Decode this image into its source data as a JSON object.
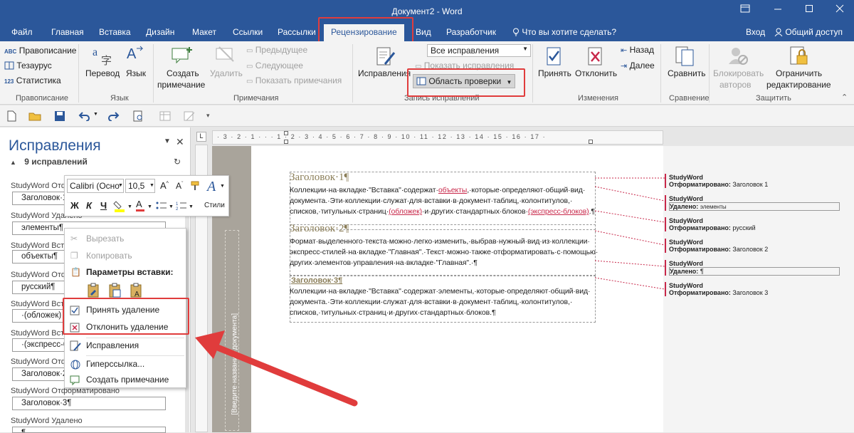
{
  "window": {
    "title": "Документ2 - Word",
    "controls": [
      "restore-ribbon",
      "minimize",
      "maximize",
      "close"
    ]
  },
  "tabs": {
    "file": "Файл",
    "home": "Главная",
    "insert": "Вставка",
    "design": "Дизайн",
    "layout": "Макет",
    "references": "Ссылки",
    "mailings": "Рассылки",
    "review": "Рецензирование",
    "view": "Вид",
    "developer": "Разработчик",
    "tell_me": "Что вы хотите сделать?",
    "signin": "Вход",
    "share": "Общий доступ"
  },
  "ribbon": {
    "proofing": {
      "spelling": "Правописание",
      "thesaurus": "Тезаурус",
      "stats": "Статистика",
      "label": "Правописание"
    },
    "language": {
      "translate": "Перевод",
      "language": "Язык",
      "label": "Язык"
    },
    "comments": {
      "new": [
        "Создать",
        "примечание"
      ],
      "delete": "Удалить",
      "previous": "Предыдущее",
      "next": "Следующее",
      "show": "Показать примечания",
      "label": "Примечания"
    },
    "tracking": {
      "track": "Исправления",
      "markup_select": "Все исправления",
      "show_markup": "Показать исправления",
      "reviewing_pane": "Область проверки",
      "label": "Запись исправлений"
    },
    "changes": {
      "accept": "Принять",
      "reject": "Отклонить",
      "back": "Назад",
      "forward": "Далее",
      "label": "Изменения"
    },
    "compare": {
      "compare": "Сравнить",
      "label": "Сравнение"
    },
    "protect": {
      "block": [
        "Блокировать",
        "авторов"
      ],
      "restrict": [
        "Ограничить",
        "редактирование"
      ],
      "label": "Защитить"
    }
  },
  "pane": {
    "title": "Исправления",
    "count": "9 исправлений",
    "entries": [
      {
        "head": "StudyWord Отф",
        "value": "Заголовок·1"
      },
      {
        "head": "StudyWord Удалено",
        "value": "элементы¶"
      },
      {
        "head": "StudyWord Вст",
        "value": "объекты¶"
      },
      {
        "head": "StudyWord Отф",
        "value": "русский¶"
      },
      {
        "head": "StudyWord Вст",
        "value": "·(обложек)"
      },
      {
        "head": "StudyWord Вст",
        "value": "·(экспресс-б"
      },
      {
        "head": "StudyWord Отф",
        "value": "Заголовок·2"
      },
      {
        "head": "StudyWord Отформатировано",
        "value": "Заголовок·3¶"
      },
      {
        "head": "StudyWord Удалено",
        "value": "¶"
      }
    ]
  },
  "minitoolbar": {
    "font": "Calibri (Осно",
    "size": "10,5",
    "styles": "Стили",
    "bold": "Ж",
    "italic": "К",
    "underline": "Ч"
  },
  "context_menu": {
    "cut": "Вырезать",
    "copy": "Копировать",
    "paste_options": "Параметры вставки:",
    "accept_deletion": "Принять удаление",
    "reject_deletion": "Отклонить удаление",
    "track_changes": "Исправления",
    "hyperlink": "Гиперссылка...",
    "new_comment": "Создать примечание"
  },
  "document": {
    "header_label": "[Введите·название·документа]",
    "h1": "Заголовок·1¶",
    "p1": [
      [
        "Коллекции·на·вкладке·\"Вставка\"·содержат·",
        "объекты",
        ",·которые·определяют·общий·вид·"
      ],
      [
        "документа.·Эти·коллекции·служат·для·вставки·в·документ·таблиц,·колонтитулов,·"
      ],
      [
        "списков,·титульных·страниц·",
        "(обложек)",
        "·и·других·стандартных·блоков·",
        "(экспресс-блоков)",
        ".¶"
      ]
    ],
    "h2": "Заголовок·2¶",
    "p2": [
      "Формат·выделенного·текста·можно·легко·изменить,·выбрав·нужный·вид·из·коллекции·",
      "экспресс-стилей·на·вкладке·\"Главная\".·Текст·можно·также·отформатировать·с·помощью·",
      "других·элементов·управления·на·вкладке·\"Главная\".·¶"
    ],
    "h3": "Заголовок·3¶",
    "p3": [
      "Коллекции·на·вкладке·\"Вставка\"·содержат·элементы,·которые·определяют·общий·вид·",
      "документа.·Эти·коллекции·служат·для·вставки·в·документ·таблиц,·колонтитулов,·",
      "списков,·титульных·страниц·и·других·стандартных·блоков.¶"
    ]
  },
  "balloons": [
    {
      "author": "StudyWord",
      "action": "Отформатировано:",
      "detail": "Заголовок 1"
    },
    {
      "author": "StudyWord",
      "action": "Удалено:",
      "detail": "элементы"
    },
    {
      "author": "StudyWord",
      "action": "Отформатировано:",
      "detail": "русский"
    },
    {
      "author": "StudyWord",
      "action": "Отформатировано:",
      "detail": "Заголовок 2"
    },
    {
      "author": "StudyWord",
      "action": "Удалено:",
      "detail": "¶"
    },
    {
      "author": "StudyWord",
      "action": "Отформатировано:",
      "detail": "Заголовок 3"
    }
  ],
  "ruler_marks": "· 3 · 2 · 1 · · · 1 · 2 · 3 · 4 · 5 · 6 · 7 · 8 · 9 · 10 · 11 · 12 · 13 · 14 · 15 · 16 · 17 ·",
  "colors": {
    "brand": "#2b579a",
    "highlight_box": "#e03c3c",
    "revision": "#c8284a",
    "heading": "#8a7d57"
  }
}
